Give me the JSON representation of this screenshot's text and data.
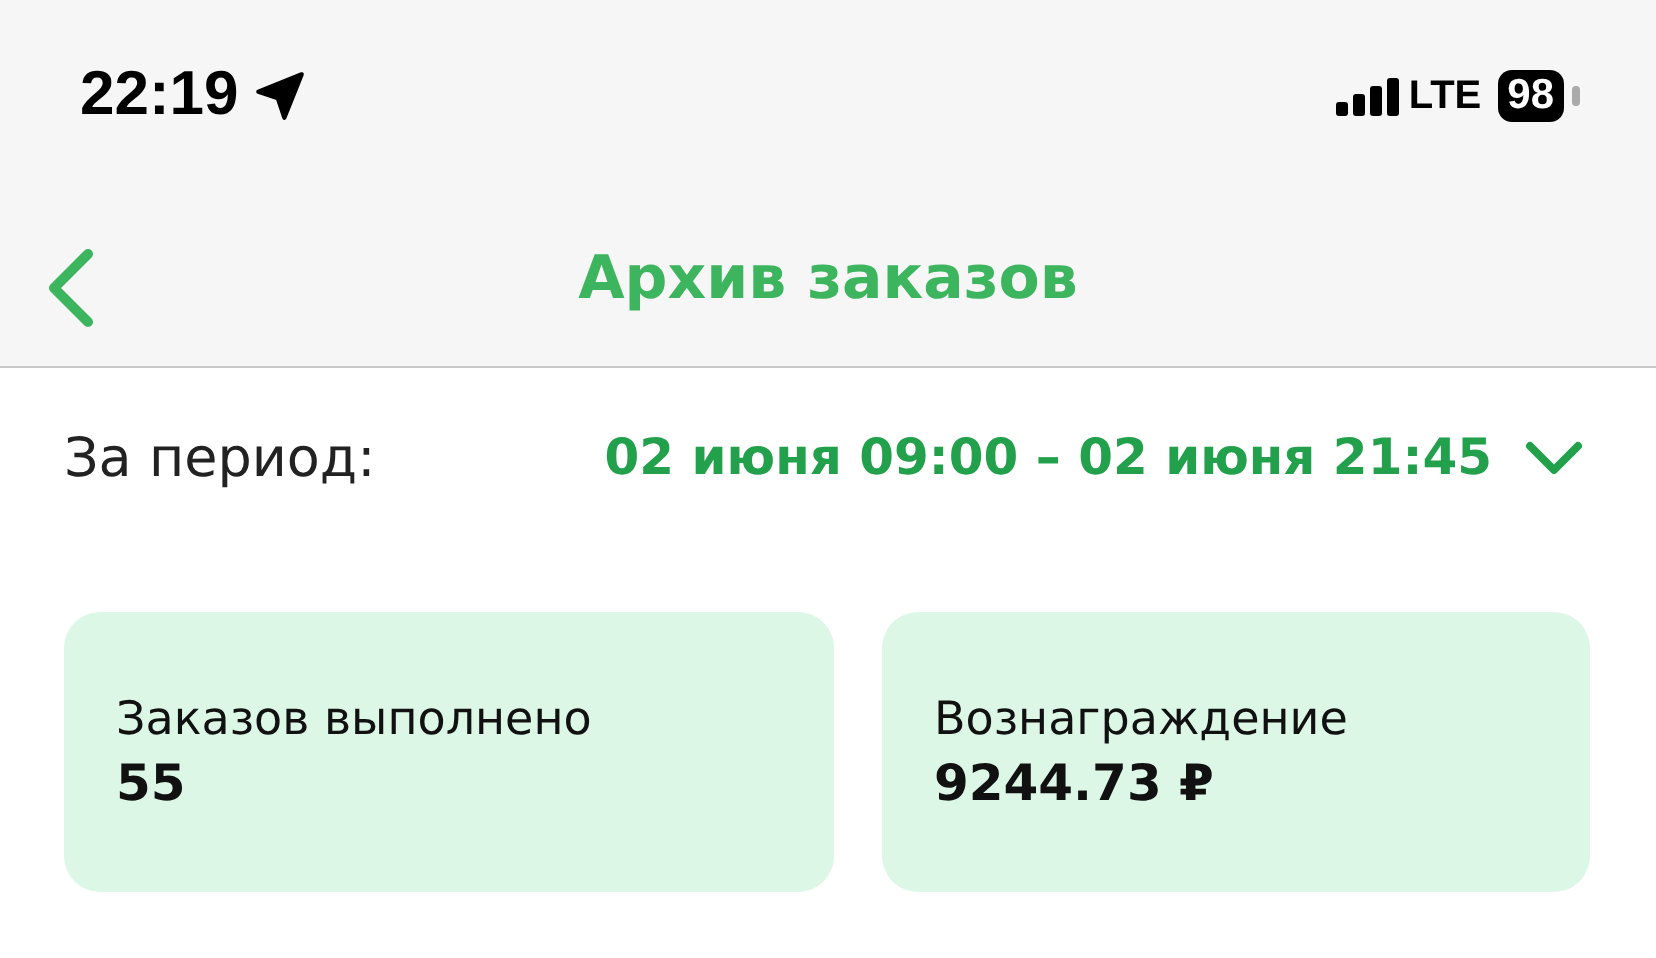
{
  "status_bar": {
    "time": "22:19",
    "network": "LTE",
    "battery": "98"
  },
  "nav_bar": {
    "title": "Архив заказов"
  },
  "period": {
    "label": "За период:",
    "value": "02 июня 09:00 – 02 июня 21:45"
  },
  "stats": [
    {
      "label": "Заказов выполнено",
      "value": "55"
    },
    {
      "label": "Вознаграждение",
      "value": "9244.73 ₽"
    }
  ]
}
